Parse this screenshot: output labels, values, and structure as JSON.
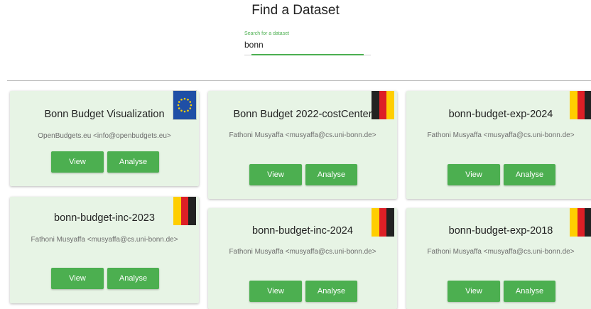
{
  "page": {
    "title": "Find a Dataset"
  },
  "search": {
    "label": "Search for a dataset",
    "value": "bonn"
  },
  "buttons": {
    "view": "View",
    "analyse": "Analyse"
  },
  "colors": {
    "accent": "#4caf50",
    "card_bg": "#e7f4e5",
    "eu_blue": "#1f4fa6",
    "eu_star": "#ffd200"
  },
  "cards": [
    {
      "title": "Bonn Budget Visualization",
      "author": "OpenBudgets.eu <info@openbudgets.eu>",
      "flag": "eu-flag-icon"
    },
    {
      "title": "Bonn Budget 2022-costCenter",
      "author": "Fathoni Musyaffa <musyaffa@cs.uni-bonn.de>",
      "flag": "germany-flag-icon"
    },
    {
      "title": "bonn-budget-exp-2024",
      "author": "Fathoni Musyaffa <musyaffa@cs.uni-bonn.de>",
      "flag": "germany-flag-icon"
    },
    {
      "title": "bonn-budget-inc-2023",
      "author": "Fathoni Musyaffa <musyaffa@cs.uni-bonn.de>",
      "flag": "germany-flag-icon"
    },
    {
      "title": "bonn-budget-inc-2024",
      "author": "Fathoni Musyaffa <musyaffa@cs.uni-bonn.de>",
      "flag": "germany-flag-icon"
    },
    {
      "title": "bonn-budget-exp-2018",
      "author": "Fathoni Musyaffa <musyaffa@cs.uni-bonn.de>",
      "flag": "germany-flag-icon"
    }
  ]
}
